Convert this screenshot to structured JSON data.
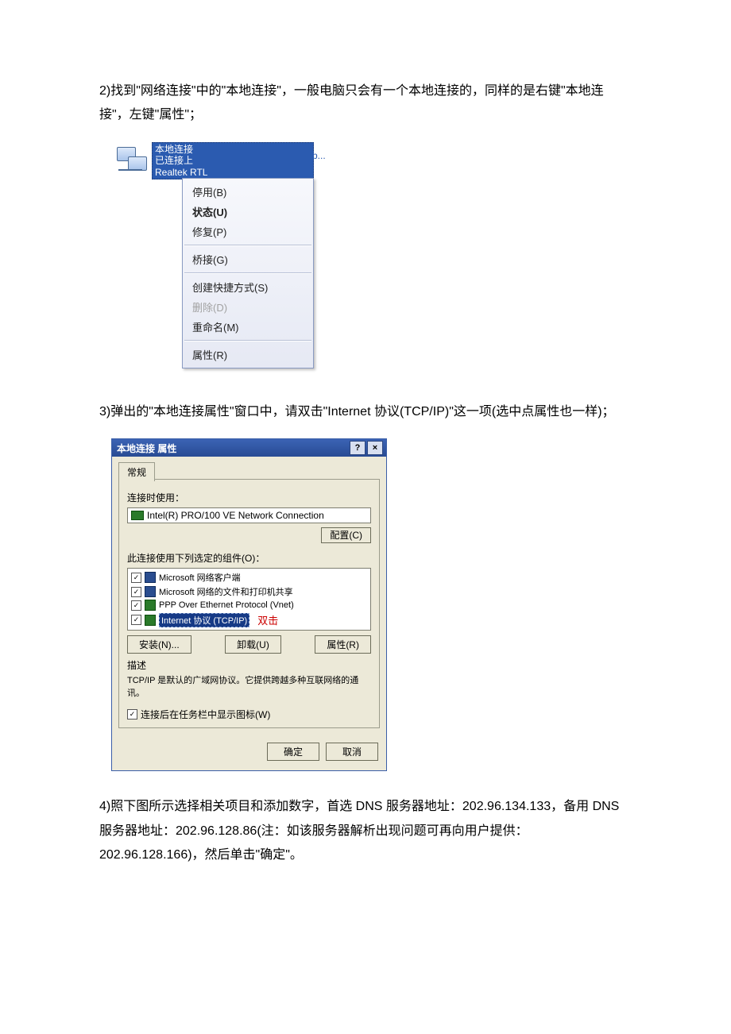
{
  "paragraphs": {
    "p1": "2)找到\"网络连接\"中的\"本地连接\"，一般电脑只会有一个本地连接的，同样的是右键\"本地连接\"，左键\"属性\"；",
    "p2": "3)弹出的\"本地连接属性\"窗口中，请双击\"Internet 协议(TCP/IP)\"这一项(选中点属性也一样)；",
    "p3": "4)照下图所示选择相关项目和添加数字，首选 DNS 服务器地址：202.96.134.133，备用 DNS 服务器地址：202.96.128.86(注：如该服务器解析出现问题可再向用户提供：202.96.128.166)，然后单击\"确定\"。"
  },
  "screenshot1": {
    "label_line1": "本地连接",
    "label_line2": "已连接上",
    "label_line3": "Realtek RTL",
    "hanger": "b...",
    "menu": {
      "disable": "停用(B)",
      "status": "状态(U)",
      "repair": "修复(P)",
      "bridge": "桥接(G)",
      "shortcut": "创建快捷方式(S)",
      "delete": "删除(D)",
      "rename": "重命名(M)",
      "properties": "属性(R)"
    }
  },
  "screenshot2": {
    "title": "本地连接 属性",
    "help_btn": "?",
    "close_btn": "×",
    "tab_general": "常规",
    "connect_using": "连接时使用：",
    "adapter": "Intel(R) PRO/100 VE Network Connection",
    "configure": "配置(C)",
    "components_label": "此连接使用下列选定的组件(O)：",
    "components": {
      "c1": "Microsoft 网络客户端",
      "c2": "Microsoft 网络的文件和打印机共享",
      "c3": "PPP Over Ethernet Protocol (Vnet)",
      "c4": "Internet 协议 (TCP/IP)"
    },
    "dblclick_note": "双击",
    "install": "安装(N)...",
    "uninstall": "卸载(U)",
    "props": "属性(R)",
    "desc_label": "描述",
    "desc_text": "TCP/IP 是默认的广域网协议。它提供跨越多种互联网络的通讯。",
    "show_tray": "连接后在任务栏中显示图标(W)",
    "ok": "确定",
    "cancel": "取消"
  }
}
